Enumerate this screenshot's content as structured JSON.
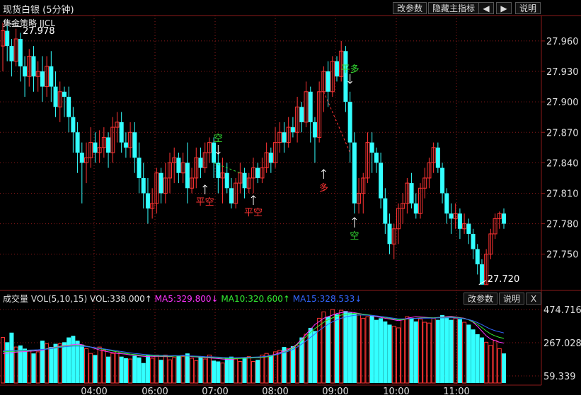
{
  "header": {
    "title": "现货白银 (5分钟)",
    "buttons": {
      "params": "改参数",
      "hide_indicator": "隐藏主指标",
      "prev": "◀",
      "next": "▶",
      "help": "说明"
    }
  },
  "strategy_label": "集金策略 JJCL",
  "price_axis": {
    "ticks": [
      "27.960",
      "27.930",
      "27.900",
      "27.870",
      "27.840",
      "27.810",
      "27.780",
      "27.750"
    ]
  },
  "annotations": {
    "high": "27.978",
    "low": "27.720",
    "signals": [
      {
        "text": "空",
        "color": "#33dd33"
      },
      {
        "text": "平空",
        "color": "#ff3333"
      },
      {
        "text": "平空",
        "color": "#ff3333"
      },
      {
        "text": "多",
        "color": "#ff3333"
      },
      {
        "text": "平多",
        "color": "#33dd33"
      },
      {
        "text": "空",
        "color": "#33dd33"
      }
    ]
  },
  "volume": {
    "label": "成交量",
    "vol_params": "VOL(5,10,15)",
    "vol": "VOL:338.000↑",
    "ma5": "MA5:329.800↓",
    "ma10": "MA10:320.600↑",
    "ma15": "MA15:328.533↓",
    "colors": {
      "vol": "#e0e0e0",
      "ma5": "#ff33ff",
      "ma10": "#33ee33",
      "ma15": "#3366ff"
    },
    "buttons": {
      "params": "改参数",
      "help": "说明",
      "close": "X"
    },
    "ticks": [
      "474.716",
      "267.028",
      "59.339"
    ]
  },
  "time_axis": [
    "04:00",
    "06:00",
    "07:00",
    "08:00",
    "09:00",
    "10:00",
    "11:00"
  ],
  "colors": {
    "up": "#ff3333",
    "down": "#33ffff",
    "grid": "#8b1a1a",
    "axis_text": "#e0e0e0"
  },
  "chart_data": {
    "type": "candlestick",
    "price_range": [
      27.715,
      27.985
    ],
    "candles": [
      [
        27.955,
        27.97,
        27.978,
        27.93
      ],
      [
        27.97,
        27.955,
        27.975,
        27.94
      ],
      [
        27.955,
        27.94,
        27.962,
        27.925
      ],
      [
        27.94,
        27.962,
        27.972,
        27.935
      ],
      [
        27.962,
        27.935,
        27.968,
        27.92
      ],
      [
        27.935,
        27.925,
        27.945,
        27.905
      ],
      [
        27.925,
        27.945,
        27.952,
        27.915
      ],
      [
        27.945,
        27.925,
        27.955,
        27.91
      ],
      [
        27.925,
        27.93,
        27.94,
        27.91
      ],
      [
        27.93,
        27.915,
        27.945,
        27.9
      ],
      [
        27.915,
        27.935,
        27.945,
        27.905
      ],
      [
        27.935,
        27.915,
        27.95,
        27.9
      ],
      [
        27.915,
        27.895,
        27.93,
        27.885
      ],
      [
        27.895,
        27.91,
        27.92,
        27.88
      ],
      [
        27.91,
        27.905,
        27.915,
        27.885
      ],
      [
        27.905,
        27.885,
        27.915,
        27.87
      ],
      [
        27.885,
        27.87,
        27.895,
        27.85
      ],
      [
        27.87,
        27.85,
        27.88,
        27.83
      ],
      [
        27.85,
        27.84,
        27.86,
        27.8
      ],
      [
        27.84,
        27.845,
        27.86,
        27.82
      ],
      [
        27.845,
        27.86,
        27.875,
        27.835
      ],
      [
        27.86,
        27.85,
        27.87,
        27.84
      ],
      [
        27.85,
        27.855,
        27.872,
        27.84
      ],
      [
        27.855,
        27.865,
        27.875,
        27.845
      ],
      [
        27.865,
        27.85,
        27.87,
        27.835
      ],
      [
        27.85,
        27.875,
        27.885,
        27.84
      ],
      [
        27.875,
        27.88,
        27.89,
        27.86
      ],
      [
        27.88,
        27.86,
        27.89,
        27.85
      ],
      [
        27.86,
        27.855,
        27.87,
        27.845
      ],
      [
        27.855,
        27.87,
        27.88,
        27.845
      ],
      [
        27.87,
        27.845,
        27.88,
        27.83
      ],
      [
        27.845,
        27.825,
        27.86,
        27.81
      ],
      [
        27.825,
        27.81,
        27.84,
        27.795
      ],
      [
        27.81,
        27.795,
        27.825,
        27.78
      ],
      [
        27.795,
        27.8,
        27.815,
        27.785
      ],
      [
        27.8,
        27.83,
        27.835,
        27.79
      ],
      [
        27.83,
        27.81,
        27.835,
        27.8
      ],
      [
        27.81,
        27.825,
        27.84,
        27.8
      ],
      [
        27.825,
        27.84,
        27.85,
        27.81
      ],
      [
        27.84,
        27.845,
        27.855,
        27.82
      ],
      [
        27.845,
        27.83,
        27.85,
        27.82
      ],
      [
        27.83,
        27.84,
        27.85,
        27.82
      ],
      [
        27.84,
        27.815,
        27.86,
        27.8
      ],
      [
        27.815,
        27.825,
        27.835,
        27.81
      ],
      [
        27.825,
        27.845,
        27.855,
        27.815
      ],
      [
        27.845,
        27.835,
        27.855,
        27.825
      ],
      [
        27.835,
        27.85,
        27.86,
        27.83
      ],
      [
        27.85,
        27.86,
        27.865,
        27.84
      ],
      [
        27.86,
        27.84,
        27.865,
        27.825
      ],
      [
        27.84,
        27.825,
        27.85,
        27.81
      ],
      [
        27.825,
        27.83,
        27.845,
        27.8
      ],
      [
        27.83,
        27.815,
        27.84,
        27.81
      ],
      [
        27.815,
        27.8,
        27.825,
        27.795
      ],
      [
        27.8,
        27.82,
        27.825,
        27.795
      ],
      [
        27.82,
        27.83,
        27.84,
        27.81
      ],
      [
        27.83,
        27.815,
        27.835,
        27.805
      ],
      [
        27.815,
        27.825,
        27.83,
        27.81
      ],
      [
        27.825,
        27.835,
        27.845,
        27.81
      ],
      [
        27.835,
        27.825,
        27.84,
        27.82
      ],
      [
        27.825,
        27.835,
        27.845,
        27.82
      ],
      [
        27.835,
        27.85,
        27.86,
        27.83
      ],
      [
        27.85,
        27.84,
        27.855,
        27.83
      ],
      [
        27.84,
        27.86,
        27.875,
        27.835
      ],
      [
        27.86,
        27.87,
        27.88,
        27.85
      ],
      [
        27.87,
        27.86,
        27.88,
        27.85
      ],
      [
        27.86,
        27.875,
        27.885,
        27.855
      ],
      [
        27.875,
        27.87,
        27.885,
        27.865
      ],
      [
        27.87,
        27.895,
        27.905,
        27.86
      ],
      [
        27.895,
        27.88,
        27.9,
        27.87
      ],
      [
        27.88,
        27.91,
        27.92,
        27.875
      ],
      [
        27.91,
        27.88,
        27.915,
        27.86
      ],
      [
        27.88,
        27.865,
        27.885,
        27.84
      ],
      [
        27.865,
        27.91,
        27.92,
        27.86
      ],
      [
        27.91,
        27.93,
        27.935,
        27.89
      ],
      [
        27.93,
        27.91,
        27.94,
        27.895
      ],
      [
        27.91,
        27.94,
        27.945,
        27.905
      ],
      [
        27.94,
        27.925,
        27.945,
        27.92
      ],
      [
        27.925,
        27.95,
        27.96,
        27.92
      ],
      [
        27.95,
        27.9,
        27.955,
        27.89
      ],
      [
        27.9,
        27.86,
        27.91,
        27.84
      ],
      [
        27.86,
        27.8,
        27.87,
        27.79
      ],
      [
        27.8,
        27.81,
        27.825,
        27.79
      ],
      [
        27.81,
        27.825,
        27.83,
        27.79
      ],
      [
        27.825,
        27.86,
        27.87,
        27.82
      ],
      [
        27.86,
        27.85,
        27.87,
        27.83
      ],
      [
        27.85,
        27.84,
        27.855,
        27.83
      ],
      [
        27.84,
        27.805,
        27.85,
        27.795
      ],
      [
        27.805,
        27.78,
        27.815,
        27.77
      ],
      [
        27.78,
        27.76,
        27.79,
        27.75
      ],
      [
        27.76,
        27.775,
        27.78,
        27.745
      ],
      [
        27.775,
        27.795,
        27.8,
        27.76
      ],
      [
        27.795,
        27.8,
        27.81,
        27.78
      ],
      [
        27.8,
        27.82,
        27.825,
        27.79
      ],
      [
        27.82,
        27.8,
        27.83,
        27.795
      ],
      [
        27.8,
        27.79,
        27.81,
        27.785
      ],
      [
        27.79,
        27.815,
        27.82,
        27.785
      ],
      [
        27.815,
        27.825,
        27.835,
        27.805
      ],
      [
        27.825,
        27.84,
        27.845,
        27.815
      ],
      [
        27.84,
        27.855,
        27.86,
        27.83
      ],
      [
        27.855,
        27.835,
        27.86,
        27.83
      ],
      [
        27.835,
        27.81,
        27.84,
        27.8
      ],
      [
        27.81,
        27.79,
        27.815,
        27.78
      ],
      [
        27.79,
        27.785,
        27.8,
        27.77
      ],
      [
        27.785,
        27.79,
        27.8,
        27.775
      ],
      [
        27.79,
        27.775,
        27.795,
        27.765
      ],
      [
        27.775,
        27.78,
        27.79,
        27.77
      ],
      [
        27.78,
        27.77,
        27.785,
        27.76
      ],
      [
        27.77,
        27.755,
        27.775,
        27.745
      ],
      [
        27.755,
        27.74,
        27.76,
        27.73
      ],
      [
        27.74,
        27.72,
        27.745,
        27.72
      ],
      [
        27.72,
        27.75,
        27.755,
        27.72
      ],
      [
        27.75,
        27.77,
        27.775,
        27.745
      ],
      [
        27.77,
        27.785,
        27.79,
        27.765
      ],
      [
        27.785,
        27.79,
        27.792,
        27.775
      ],
      [
        27.79,
        27.78,
        27.795,
        27.775
      ]
    ],
    "volumes": [
      300,
      270,
      330,
      240,
      250,
      230,
      215,
      200,
      210,
      280,
      260,
      240,
      260,
      260,
      270,
      300,
      310,
      280,
      255,
      230,
      200,
      190,
      240,
      220,
      180,
      200,
      210,
      180,
      170,
      165,
      185,
      175,
      140,
      190,
      170,
      190,
      160,
      190,
      160,
      175,
      185,
      180,
      200,
      170,
      155,
      180,
      165,
      190,
      155,
      150,
      140,
      170,
      180,
      165,
      150,
      170,
      180,
      150,
      160,
      190,
      200,
      190,
      210,
      220,
      240,
      230,
      245,
      250,
      300,
      320,
      360,
      340,
      420,
      460,
      430,
      475,
      445,
      470,
      465,
      455,
      450,
      440,
      420,
      430,
      435,
      410,
      420,
      400,
      380,
      370,
      360,
      410,
      430,
      420,
      400,
      415,
      395,
      390,
      420,
      410,
      440,
      430,
      410,
      420,
      415,
      395,
      380,
      350,
      320,
      300,
      270,
      250,
      280,
      230,
      200
    ],
    "ma5": [
      200,
      202,
      205,
      208,
      210,
      212,
      214,
      215,
      217,
      220,
      230,
      235,
      240,
      245,
      250,
      252,
      255,
      258,
      255,
      245,
      240,
      230,
      222,
      215,
      210,
      205,
      200,
      198,
      195,
      190,
      188,
      185,
      182,
      180,
      180,
      182,
      181,
      180,
      180,
      183,
      185,
      188,
      185,
      180,
      178,
      175,
      173,
      172,
      170,
      168,
      165,
      163,
      162,
      168,
      170,
      172,
      174,
      173,
      172,
      175,
      180,
      188,
      195,
      205,
      215,
      225,
      240,
      260,
      290,
      320,
      350,
      380,
      400,
      420,
      430,
      440,
      450,
      455,
      460,
      458,
      455,
      450,
      445,
      440,
      435,
      430,
      425,
      420,
      415,
      410,
      405,
      410,
      420,
      425,
      430,
      428,
      426,
      424,
      422,
      425,
      428,
      430,
      432,
      428,
      424,
      420,
      410,
      395,
      370,
      340,
      310,
      290,
      280,
      270,
      265
    ],
    "ma10": [
      210,
      212,
      213,
      214,
      215,
      216,
      218,
      220,
      222,
      225,
      228,
      232,
      238,
      242,
      246,
      248,
      250,
      250,
      248,
      245,
      240,
      235,
      230,
      225,
      220,
      215,
      210,
      205,
      200,
      196,
      193,
      190,
      188,
      186,
      185,
      184,
      183,
      183,
      182,
      183,
      184,
      185,
      184,
      182,
      180,
      178,
      176,
      175,
      174,
      172,
      170,
      169,
      168,
      168,
      169,
      170,
      171,
      172,
      173,
      175,
      178,
      183,
      190,
      198,
      208,
      220,
      235,
      255,
      280,
      305,
      330,
      355,
      375,
      395,
      410,
      422,
      432,
      440,
      445,
      448,
      450,
      448,
      445,
      442,
      438,
      434,
      430,
      425,
      420,
      415,
      410,
      412,
      415,
      418,
      420,
      422,
      423,
      423,
      423,
      424,
      425,
      426,
      427,
      425,
      422,
      418,
      410,
      398,
      382,
      362,
      340,
      322,
      310,
      300,
      295
    ],
    "ma15": [
      215,
      216,
      217,
      218,
      219,
      220,
      221,
      222,
      223,
      225,
      227,
      230,
      234,
      238,
      242,
      244,
      246,
      246,
      245,
      243,
      240,
      236,
      232,
      228,
      224,
      220,
      216,
      212,
      208,
      204,
      200,
      197,
      194,
      192,
      190,
      189,
      188,
      187,
      186,
      186,
      186,
      186,
      185,
      184,
      183,
      182,
      180,
      179,
      178,
      177,
      176,
      175,
      174,
      174,
      174,
      175,
      176,
      177,
      178,
      180,
      183,
      187,
      192,
      198,
      205,
      214,
      225,
      240,
      258,
      278,
      300,
      322,
      344,
      364,
      382,
      398,
      410,
      420,
      428,
      434,
      438,
      440,
      440,
      439,
      437,
      435,
      432,
      428,
      424,
      420,
      416,
      416,
      417,
      418,
      419,
      420,
      421,
      421,
      421,
      422,
      422,
      423,
      423,
      422,
      420,
      417,
      412,
      404,
      393,
      380,
      365,
      352,
      342,
      335,
      328
    ]
  }
}
